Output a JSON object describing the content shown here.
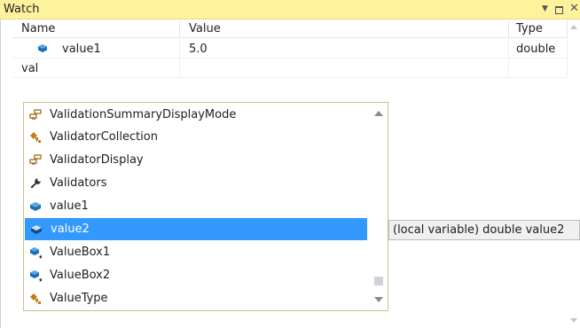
{
  "window": {
    "title": "Watch"
  },
  "columns": {
    "name": "Name",
    "value": "Value",
    "type": "Type"
  },
  "rows": [
    {
      "name": "value1",
      "value": "5.0",
      "type": "double"
    },
    {
      "name": "val",
      "value": "",
      "type": ""
    }
  ],
  "completion": {
    "items": [
      {
        "label": "ValidationSummaryDisplayMode",
        "icon": "enum-icon"
      },
      {
        "label": "ValidatorCollection",
        "icon": "class-icon"
      },
      {
        "label": "ValidatorDisplay",
        "icon": "enum-icon"
      },
      {
        "label": "Validators",
        "icon": "wrench-property-icon"
      },
      {
        "label": "value1",
        "icon": "local-variable-icon"
      },
      {
        "label": "value2",
        "icon": "local-variable-icon",
        "selected": true
      },
      {
        "label": "ValueBox1",
        "icon": "field-icon"
      },
      {
        "label": "ValueBox2",
        "icon": "field-icon"
      },
      {
        "label": "ValueType",
        "icon": "class-icon"
      }
    ]
  },
  "tooltip": {
    "text": "(local variable) double value2"
  },
  "colors": {
    "title_bg": "#fff29d",
    "selection": "#3399ff",
    "tooltip_bg": "#f0f0f0",
    "variable_icon": "#1b6fb5"
  }
}
